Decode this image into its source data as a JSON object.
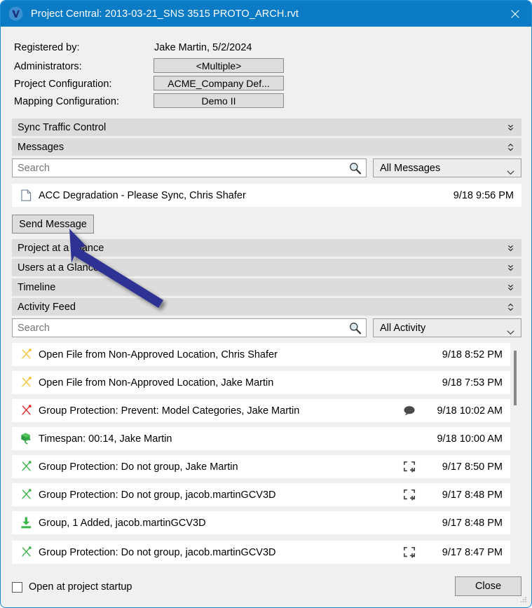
{
  "window": {
    "title": "Project Central: 2013-03-21_SNS 3515 PROTO_ARCH.rvt",
    "app_icon": "project-central-logo",
    "close_icon": "close-icon",
    "titlebar_color": "#0a7bc4",
    "border_color": "#1b8bd0"
  },
  "header": {
    "fields": [
      {
        "label": "Registered by:",
        "value": "Jake Martin, 5/2/2024",
        "type": "text"
      },
      {
        "label": "Administrators:",
        "value": "<Multiple>",
        "type": "button"
      },
      {
        "label": "Project Configuration:",
        "value": "ACME_Company Def...",
        "type": "button"
      },
      {
        "label": "Mapping Configuration:",
        "value": "Demo II",
        "type": "button"
      }
    ]
  },
  "sections": [
    {
      "id": "sync-traffic-control",
      "label": "Sync Traffic Control",
      "expanded": false,
      "icon": "chevron-double-down-icon"
    },
    {
      "id": "messages",
      "label": "Messages",
      "expanded": true,
      "icon": "chevron-double-collapse-icon"
    },
    {
      "id": "project-at-a-glance",
      "label": "Project at a Glance",
      "expanded": false,
      "icon": "chevron-double-down-icon"
    },
    {
      "id": "users-at-a-glance",
      "label": "Users at a Glance",
      "expanded": false,
      "icon": "chevron-double-down-icon"
    },
    {
      "id": "timeline",
      "label": "Timeline",
      "expanded": false,
      "icon": "chevron-double-down-icon"
    },
    {
      "id": "activity-feed",
      "label": "Activity Feed",
      "expanded": true,
      "icon": "chevron-double-collapse-icon"
    }
  ],
  "messages": {
    "search_placeholder": "Search",
    "search_value": "",
    "search_icon": "search-icon",
    "filter_selected": "All Messages",
    "filter_options": [
      "All Messages"
    ],
    "dropdown_icon": "chevron-down-icon",
    "rows": [
      {
        "icon": "document-icon",
        "text": "ACC Degradation - Please Sync, Chris Shafer",
        "date": "9/18 9:56 PM",
        "badge": ""
      }
    ],
    "send_button": "Send Message"
  },
  "activity": {
    "search_placeholder": "Search",
    "search_value": "",
    "search_icon": "search-icon",
    "filter_selected": "All Activity",
    "filter_options": [
      "All Activity"
    ],
    "dropdown_icon": "chevron-down-icon",
    "rows": [
      {
        "icon": "tools-warning-icon",
        "icon_color": "#f5c33a",
        "text": "Open File from Non-Approved Location, Chris Shafer",
        "badge": "",
        "date": "9/18 8:52 PM"
      },
      {
        "icon": "tools-warning-icon",
        "icon_color": "#f5c33a",
        "text": "Open File from Non-Approved Location, Jake Martin",
        "badge": "",
        "date": "9/18 7:53 PM"
      },
      {
        "icon": "tools-error-icon",
        "icon_color": "#e02b2b",
        "text": "Group Protection: Prevent: Model Categories, Jake Martin",
        "badge": "comment-icon",
        "date": "9/18 10:02 AM"
      },
      {
        "icon": "timespan-sync-icon",
        "icon_color": "#3cb54a",
        "text": "Timespan: 00:14, Jake Martin",
        "badge": "",
        "date": "9/18 10:00 AM"
      },
      {
        "icon": "tools-ok-icon",
        "icon_color": "#3cb54a",
        "text": "Group Protection: Do not group, Jake Martin",
        "badge": "selection-add-icon",
        "date": "9/17 8:50 PM"
      },
      {
        "icon": "tools-ok-icon",
        "icon_color": "#3cb54a",
        "text": "Group Protection: Do not group, jacob.martinGCV3D",
        "badge": "selection-add-icon",
        "date": "9/17 8:48 PM"
      },
      {
        "icon": "download-icon",
        "icon_color": "#3cb54a",
        "text": "Group, 1 Added, jacob.martinGCV3D",
        "badge": "",
        "date": "9/17 8:48 PM"
      },
      {
        "icon": "tools-ok-icon",
        "icon_color": "#3cb54a",
        "text": "Group Protection: Do not group, jacob.martinGCV3D",
        "badge": "selection-add-icon",
        "date": "9/17 8:47 PM"
      }
    ]
  },
  "footer": {
    "checkbox_label": "Open at project startup",
    "checkbox_checked": false,
    "close_button": "Close"
  },
  "annotation": {
    "type": "arrow",
    "color": "#2e3192",
    "points_to": "send-message-button"
  }
}
